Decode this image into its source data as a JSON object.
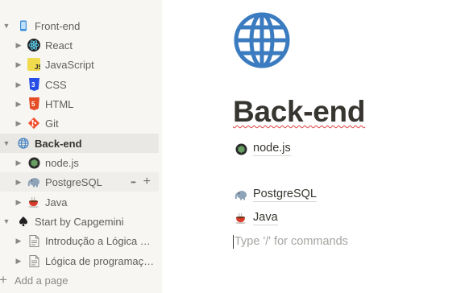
{
  "sidebar": {
    "items": [
      {
        "label": "Front-end",
        "icon": "mobile-phone-icon"
      },
      {
        "label": "React",
        "icon": "react-icon"
      },
      {
        "label": "JavaScript",
        "icon": "javascript-icon"
      },
      {
        "label": "CSS",
        "icon": "css3-icon"
      },
      {
        "label": "HTML",
        "icon": "html5-icon"
      },
      {
        "label": "Git",
        "icon": "git-icon"
      },
      {
        "label": "Back-end",
        "icon": "globe-icon"
      },
      {
        "label": "node.js",
        "icon": "nodejs-icon"
      },
      {
        "label": "PostgreSQL",
        "icon": "elephant-icon"
      },
      {
        "label": "Java",
        "icon": "coffee-icon"
      },
      {
        "label": "Start by Capgemini",
        "icon": "spade-icon"
      },
      {
        "label": "Introdução a Lógica …",
        "icon": "document-icon"
      },
      {
        "label": "Lógica de programaç…",
        "icon": "document-icon"
      }
    ],
    "more_glyph": "•••",
    "add_glyph": "+",
    "add_page_label": "Add a page",
    "selected_color": "#e9e8e4"
  },
  "page": {
    "title": "Back-end",
    "subpages": [
      {
        "label": "node.js",
        "icon": "nodejs-icon"
      },
      {
        "label": "PostgreSQL",
        "icon": "elephant-icon"
      },
      {
        "label": "Java",
        "icon": "coffee-icon"
      }
    ],
    "placeholder": "Type '/' for commands",
    "icon": "globe-icon",
    "accent": "#3b7bbf"
  }
}
